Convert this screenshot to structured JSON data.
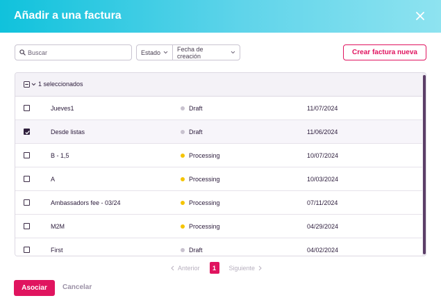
{
  "header": {
    "title": "Añadir a una factura",
    "close_icon": "close-icon"
  },
  "toolbar": {
    "search_placeholder": "Buscar",
    "search_value": "",
    "filters": [
      {
        "label": "Estado"
      },
      {
        "label": "Fecha de creación"
      }
    ],
    "create_label": "Crear factura nueva"
  },
  "table": {
    "selection_label": "1 seleccionados",
    "rows": [
      {
        "name": "Jueves1",
        "status": "Draft",
        "date": "11/07/2024",
        "checked": false
      },
      {
        "name": "Desde listas",
        "status": "Draft",
        "date": "11/06/2024",
        "checked": true
      },
      {
        "name": "B - 1,5",
        "status": "Processing",
        "date": "10/07/2024",
        "checked": false
      },
      {
        "name": "A",
        "status": "Processing",
        "date": "10/03/2024",
        "checked": false
      },
      {
        "name": "Ambassadors fee - 03/24",
        "status": "Processing",
        "date": "07/11/2024",
        "checked": false
      },
      {
        "name": "M2M",
        "status": "Processing",
        "date": "04/29/2024",
        "checked": false
      },
      {
        "name": "First",
        "status": "Draft",
        "date": "04/02/2024",
        "checked": false
      }
    ]
  },
  "pagination": {
    "prev_label": "Anterior",
    "current_page": "1",
    "next_label": "Siguiente"
  },
  "footer": {
    "associate_label": "Asociar",
    "cancel_label": "Cancelar"
  },
  "colors": {
    "accent": "#e0145f",
    "draft_dot": "#c8c2cf",
    "processing_dot": "#f5c400",
    "header_gradient_start": "#10c2dc",
    "header_gradient_end": "#8ee3f0"
  }
}
